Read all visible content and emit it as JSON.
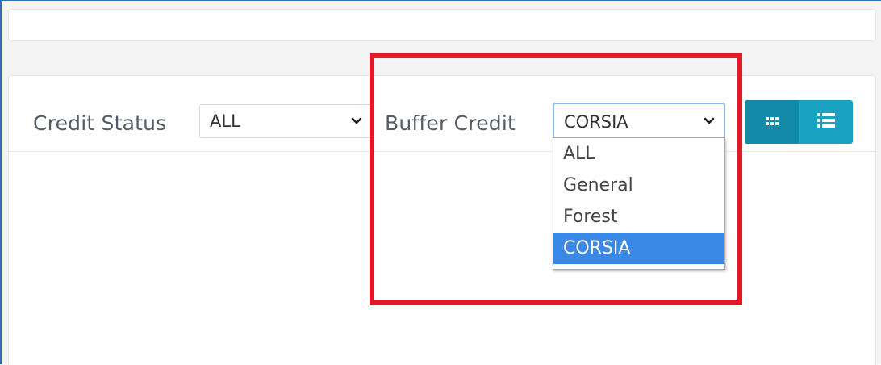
{
  "filters": {
    "credit_status": {
      "label": "Credit Status",
      "selected": "ALL"
    },
    "buffer_credit": {
      "label": "Buffer Credit",
      "selected": "CORSIA",
      "options": [
        "ALL",
        "General",
        "Forest",
        "CORSIA"
      ],
      "highlighted_option": "CORSIA"
    }
  },
  "view_toggle": {
    "buttons": [
      {
        "icon": "grid-icon",
        "active": true
      },
      {
        "icon": "list-icon",
        "active": false
      }
    ]
  },
  "colors": {
    "accent": "#1aa2c3",
    "accent_active": "#148aa9",
    "highlight_option": "#3a88e6",
    "annotation_box": "#e31a22"
  }
}
